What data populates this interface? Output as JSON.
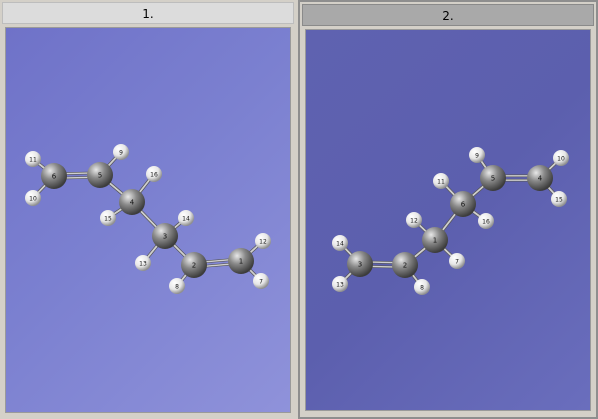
{
  "windows": [
    {
      "title": "1.",
      "atoms": [
        {
          "label": "1",
          "element": "C"
        },
        {
          "label": "2",
          "element": "C"
        },
        {
          "label": "3",
          "element": "C"
        },
        {
          "label": "4",
          "element": "C"
        },
        {
          "label": "5",
          "element": "C"
        },
        {
          "label": "6",
          "element": "C"
        },
        {
          "label": "7",
          "element": "H"
        },
        {
          "label": "8",
          "element": "H"
        },
        {
          "label": "9",
          "element": "H"
        },
        {
          "label": "10",
          "element": "H"
        },
        {
          "label": "11",
          "element": "H"
        },
        {
          "label": "12",
          "element": "H"
        },
        {
          "label": "13",
          "element": "H"
        },
        {
          "label": "14",
          "element": "H"
        },
        {
          "label": "15",
          "element": "H"
        },
        {
          "label": "16",
          "element": "H"
        }
      ]
    },
    {
      "title": "2.",
      "atoms": [
        {
          "label": "1",
          "element": "C"
        },
        {
          "label": "2",
          "element": "C"
        },
        {
          "label": "3",
          "element": "C"
        },
        {
          "label": "4",
          "element": "C"
        },
        {
          "label": "5",
          "element": "C"
        },
        {
          "label": "6",
          "element": "C"
        },
        {
          "label": "7",
          "element": "H"
        },
        {
          "label": "8",
          "element": "H"
        },
        {
          "label": "9",
          "element": "H"
        },
        {
          "label": "10",
          "element": "H"
        },
        {
          "label": "11",
          "element": "H"
        },
        {
          "label": "12",
          "element": "H"
        },
        {
          "label": "13",
          "element": "H"
        },
        {
          "label": "14",
          "element": "H"
        },
        {
          "label": "15",
          "element": "H"
        },
        {
          "label": "16",
          "element": "H"
        }
      ]
    }
  ],
  "colors": {
    "carbon": "#8a8a8a",
    "hydrogen": "#e6e6e6",
    "bond": "#cfcfcf"
  }
}
